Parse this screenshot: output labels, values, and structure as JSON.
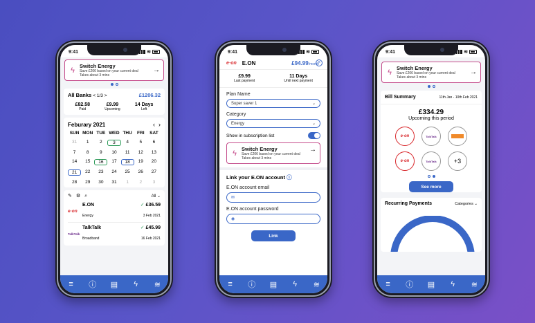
{
  "status": {
    "time": "9:41"
  },
  "banner": {
    "title": "Switch Energy",
    "line1": "Save £206 based on your current deal",
    "line2": "Takes about 3 mins",
    "arrow": "→"
  },
  "p1": {
    "banks": "All Banks",
    "banks_pager": "< 1/3 >",
    "total": "£1206.32",
    "stats": [
      {
        "v": "£82.58",
        "l": "Paid"
      },
      {
        "v": "£9.99",
        "l": "Upcoming"
      },
      {
        "v": "14 Days",
        "l": "Left"
      }
    ],
    "month": "Feburary 2021",
    "prev": "‹",
    "next": "›",
    "days": [
      "SUN",
      "MON",
      "TUE",
      "WED",
      "THU",
      "FRI",
      "SAT"
    ],
    "cal": [
      "31",
      "1",
      "2",
      "3",
      "4",
      "5",
      "6",
      "7",
      "8",
      "9",
      "10",
      "11",
      "12",
      "13",
      "14",
      "15",
      "16",
      "17",
      "18",
      "19",
      "20",
      "21",
      "22",
      "23",
      "24",
      "25",
      "26",
      "27",
      "28",
      "29",
      "30",
      "31",
      "1",
      "2",
      "3"
    ],
    "filter": "All ⌄",
    "tx": [
      {
        "logo": "e·on",
        "name": "E.ON",
        "cat": "Energy",
        "amt": "£36.59",
        "date": "3 Feb 2021"
      },
      {
        "logo": "TalkTalk",
        "name": "TalkTalk",
        "cat": "Broadband",
        "amt": "£45.99",
        "date": "16 Feb 2021"
      }
    ]
  },
  "p2": {
    "logo": "e·on",
    "name": "E.ON",
    "price": "£94.99",
    "per": "/month",
    "stats": [
      {
        "v": "£9.99",
        "l": "Last payment"
      },
      {
        "v": "11 Days",
        "l": "Until next payment"
      }
    ],
    "plan_label": "Plan Name",
    "plan_value": "Super saver 1",
    "cat_label": "Category",
    "cat_value": "Energy",
    "show_label": "Show in subscription list",
    "link_title": "Link your E.ON account",
    "email_label": "E.ON account email",
    "pw_label": "E.ON account password",
    "link_btn": "Link"
  },
  "p3": {
    "title": "Bill Summary",
    "range": "11th Jan - 10th Feb 2021",
    "amount": "£334.29",
    "sub": "Upcoming this period",
    "logos": [
      "e·on",
      "TalkTalk",
      "",
      "e·on",
      "TalkTalk",
      "+3"
    ],
    "see_more": "See more",
    "rec_title": "Recurring Payments",
    "rec_filter": "Categories ⌄"
  },
  "colors": {
    "brand": "#3a67c7",
    "accent": "#c44a8a",
    "eon": "#d8262a",
    "green": "#2c9a58"
  },
  "tabbar_icons": [
    "menu-icon",
    "info-icon",
    "list-icon",
    "bolt-icon",
    "wifi-icon"
  ]
}
